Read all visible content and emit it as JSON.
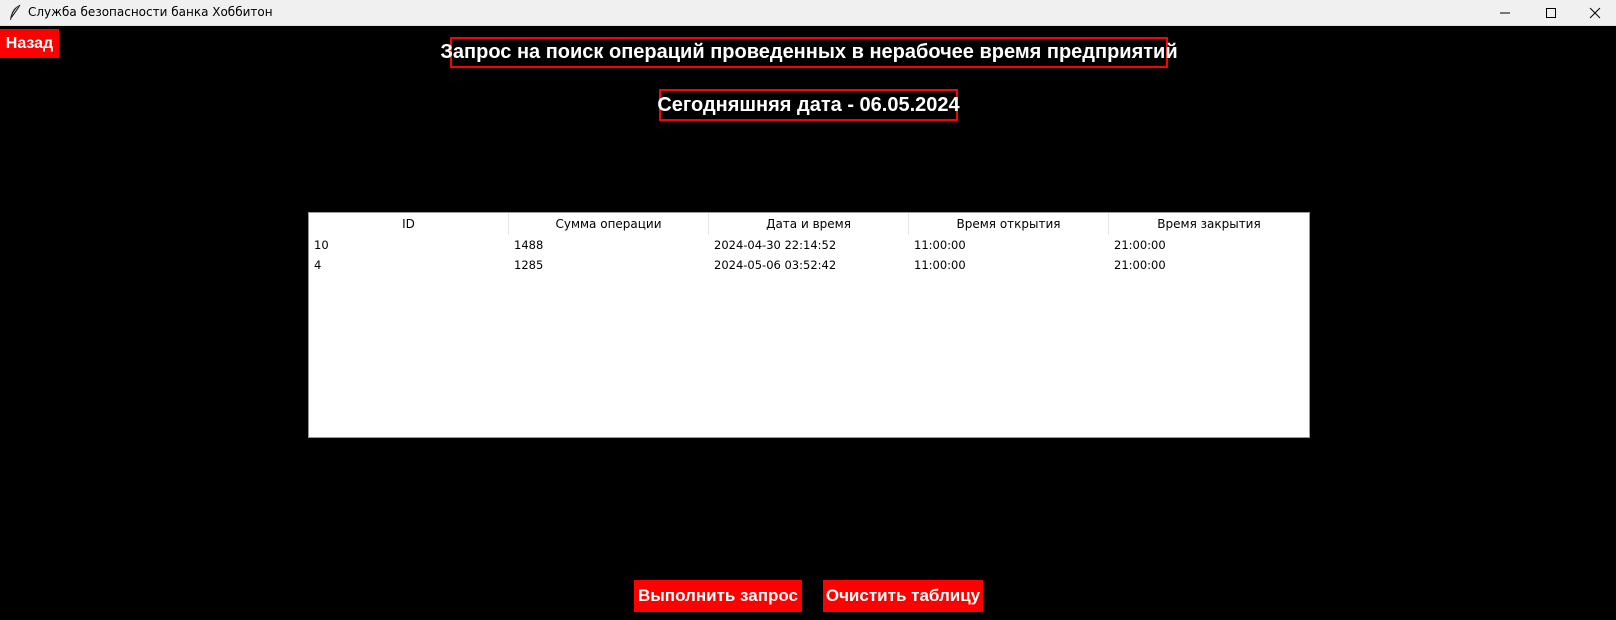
{
  "window": {
    "title": "Служба безопасности банка Хоббитон",
    "app_icon": "feather-icon",
    "controls": [
      "minimize-icon",
      "maximize-icon",
      "close-icon"
    ]
  },
  "back_button": {
    "label": "Назад"
  },
  "heading": "Запрос на поиск операций проведенных в нерабочее время предприятий",
  "date_label": "Сегодняшняя дата - 06.05.2024",
  "table": {
    "columns": [
      "ID",
      "Сумма операции",
      "Дата и время",
      "Время открытия",
      "Время закрытия"
    ],
    "rows": [
      [
        "10",
        "1488",
        "2024-04-30 22:14:52",
        "11:00:00",
        "21:00:00"
      ],
      [
        "4",
        "1285",
        "2024-05-06 03:52:42",
        "11:00:00",
        "21:00:00"
      ]
    ]
  },
  "actions": {
    "run_label": "Выполнить запрос",
    "clear_label": "Очистить таблицу"
  },
  "colors": {
    "accent": "#ff0000",
    "background": "#000000",
    "text": "#ffffff",
    "table_bg": "#ffffff"
  }
}
